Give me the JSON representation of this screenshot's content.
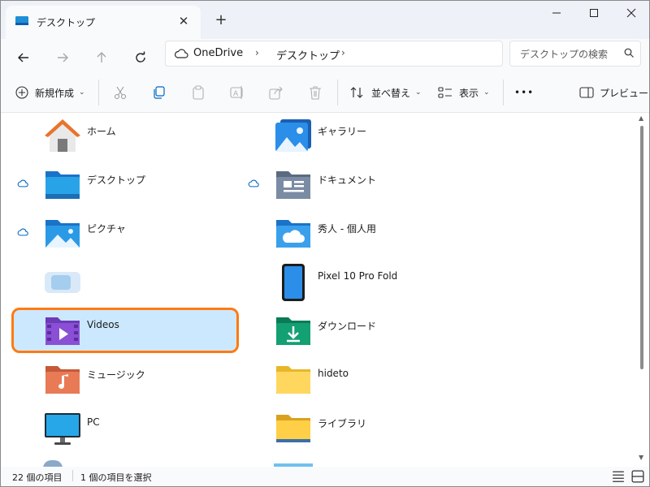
{
  "window": {
    "tab_title": "デスクトップ",
    "new_tab": "+"
  },
  "nav": {
    "breadcrumb": [
      "OneDrive",
      "デスクトップ"
    ],
    "search_placeholder": "デスクトップの検索"
  },
  "toolbar": {
    "new_label": "新規作成",
    "sort_label": "並べ替え",
    "view_label": "表示",
    "more_label": "•••",
    "preview_label": "プレビュー"
  },
  "items_left": [
    {
      "label": "ホーム",
      "icon": "home-icon",
      "cloud": false
    },
    {
      "label": "デスクトップ",
      "icon": "desktop-folder-icon",
      "cloud": true
    },
    {
      "label": "ピクチャ",
      "icon": "pictures-folder-icon",
      "cloud": true
    },
    {
      "label": "",
      "icon": "blurred-item-icon",
      "cloud": false
    },
    {
      "label": "Videos",
      "icon": "videos-folder-icon",
      "cloud": false,
      "selected": true
    },
    {
      "label": "ミュージック",
      "icon": "music-folder-icon",
      "cloud": false
    },
    {
      "label": "PC",
      "icon": "pc-monitor-icon",
      "cloud": false
    }
  ],
  "items_right": [
    {
      "label": "ギャラリー",
      "icon": "gallery-icon",
      "cloud": false
    },
    {
      "label": "ドキュメント",
      "icon": "documents-folder-icon",
      "cloud": true
    },
    {
      "label": "秀人 - 個人用",
      "icon": "onedrive-folder-icon",
      "cloud": false
    },
    {
      "label": "Pixel 10 Pro Fold",
      "icon": "phone-icon",
      "cloud": false
    },
    {
      "label": "ダウンロード",
      "icon": "downloads-folder-icon",
      "cloud": false
    },
    {
      "label": "hideto",
      "icon": "user-folder-icon",
      "cloud": false
    },
    {
      "label": "ライブラリ",
      "icon": "libraries-folder-icon",
      "cloud": false
    }
  ],
  "status": {
    "item_count": "22 個の項目",
    "selection": "1 個の項目を選択"
  },
  "colors": {
    "selection_bg": "#cce8ff",
    "highlight_border": "#ff7a12",
    "accent": "#0067c0"
  }
}
